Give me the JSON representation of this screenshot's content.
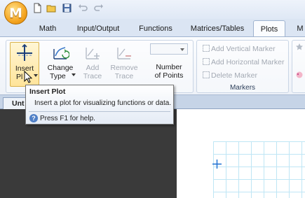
{
  "app": {
    "logo_letter": "M"
  },
  "quick_access": [
    {
      "icon": "new-document-icon"
    },
    {
      "icon": "open-folder-icon"
    },
    {
      "icon": "save-icon"
    },
    {
      "icon": "undo-icon"
    },
    {
      "icon": "redo-icon"
    }
  ],
  "tabs": [
    {
      "label": "Math"
    },
    {
      "label": "Input/Output"
    },
    {
      "label": "Functions"
    },
    {
      "label": "Matrices/Tables"
    },
    {
      "label": "Plots",
      "active": true
    },
    {
      "label": "M"
    }
  ],
  "ribbon": {
    "insert_plot_label": "Insert Plot",
    "insert_plot_visible_line1": "Insert",
    "insert_plot_visible_line2": "Pl",
    "change_type": {
      "line1": "Change",
      "line2": "Type"
    },
    "add_trace": {
      "line1": "Add",
      "line2": "Trace"
    },
    "remove_trace": {
      "line1": "Remove",
      "line2": "Trace"
    },
    "number_of_points": {
      "line1": "Number",
      "line2": "of Points"
    },
    "markers": {
      "add_vertical": "Add Vertical Marker",
      "add_horizontal": "Add Horizontal Marker",
      "delete": "Delete Marker",
      "group_label": "Markers"
    }
  },
  "document": {
    "tab_label": "Unt"
  },
  "tooltip": {
    "title": "Insert Plot",
    "description": "Insert a plot for visualizing functions or data.",
    "help": "Press F1 for help."
  },
  "colors": {
    "accent": "#f5a623",
    "ribbon_border": "#9fb3cf",
    "grid_line": "#bfe6f5",
    "plot_crosshair": "#1b6fd1"
  }
}
